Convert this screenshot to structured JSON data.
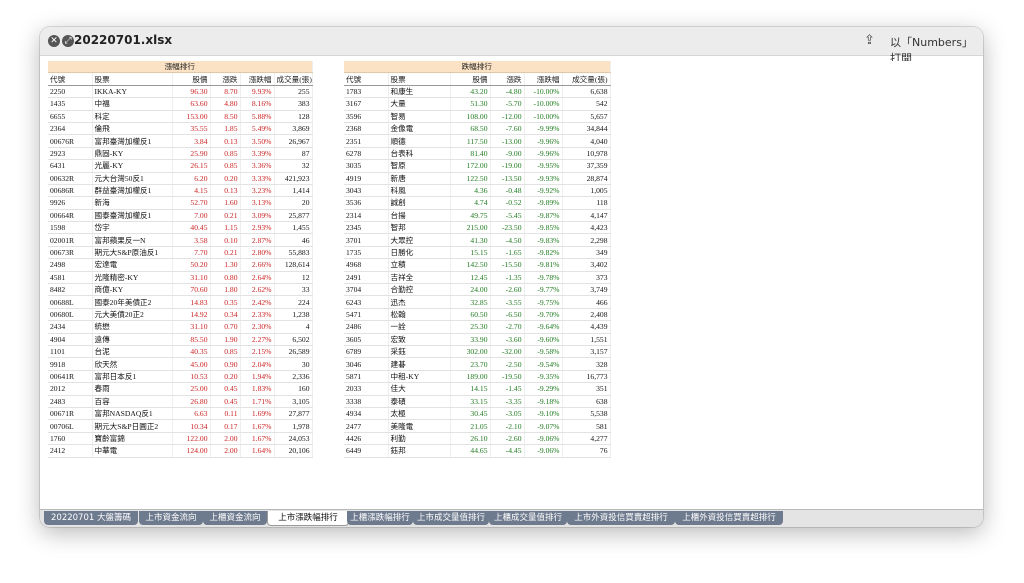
{
  "window": {
    "title": "20220701.xlsx",
    "open_with": "以「Numbers」打開"
  },
  "gainers": {
    "title": "漲幅排行",
    "columns": [
      "代號",
      "股票",
      "股價",
      "漲跌",
      "漲跌幅",
      "成交量(張)"
    ],
    "rows": [
      [
        "2250",
        "IKKA-KY",
        "96.30",
        "8.70",
        "9.93%",
        "255"
      ],
      [
        "1435",
        "中福",
        "63.60",
        "4.80",
        "8.16%",
        "383"
      ],
      [
        "6655",
        "科定",
        "153.00",
        "8.50",
        "5.88%",
        "128"
      ],
      [
        "2364",
        "倫飛",
        "35.55",
        "1.85",
        "5.49%",
        "3,869"
      ],
      [
        "00676R",
        "富邦臺灣加權反1",
        "3.84",
        "0.13",
        "3.50%",
        "26,967"
      ],
      [
        "2923",
        "鼎固-KY",
        "25.90",
        "0.85",
        "3.39%",
        "87"
      ],
      [
        "6431",
        "光麗-KY",
        "26.15",
        "0.85",
        "3.36%",
        "32"
      ],
      [
        "00632R",
        "元大台灣50反1",
        "6.20",
        "0.20",
        "3.33%",
        "421,923"
      ],
      [
        "00686R",
        "群益臺灣加權反1",
        "4.15",
        "0.13",
        "3.23%",
        "1,414"
      ],
      [
        "9926",
        "新海",
        "52.70",
        "1.60",
        "3.13%",
        "20"
      ],
      [
        "00664R",
        "國泰臺灣加權反1",
        "7.00",
        "0.21",
        "3.09%",
        "25,877"
      ],
      [
        "1598",
        "岱宇",
        "40.45",
        "1.15",
        "2.93%",
        "1,455"
      ],
      [
        "02001R",
        "富邦蘋果反一N",
        "3.58",
        "0.10",
        "2.87%",
        "46"
      ],
      [
        "00673R",
        "期元大S&P原油反1",
        "7.70",
        "0.21",
        "2.80%",
        "55,883"
      ],
      [
        "2498",
        "宏達電",
        "50.20",
        "1.30",
        "2.66%",
        "128,614"
      ],
      [
        "4581",
        "光隆精密-KY",
        "31.10",
        "0.80",
        "2.64%",
        "12"
      ],
      [
        "8482",
        "商億-KY",
        "70.60",
        "1.80",
        "2.62%",
        "33"
      ],
      [
        "00688L",
        "國泰20年美債正2",
        "14.83",
        "0.35",
        "2.42%",
        "224"
      ],
      [
        "00680L",
        "元大美債20正2",
        "14.92",
        "0.34",
        "2.33%",
        "1,238"
      ],
      [
        "2434",
        "統懋",
        "31.10",
        "0.70",
        "2.30%",
        "4"
      ],
      [
        "4904",
        "遠傳",
        "85.50",
        "1.90",
        "2.27%",
        "6,502"
      ],
      [
        "1101",
        "台泥",
        "40.35",
        "0.85",
        "2.15%",
        "26,589"
      ],
      [
        "9918",
        "欣天然",
        "45.00",
        "0.90",
        "2.04%",
        "30"
      ],
      [
        "00641R",
        "富邦日本反1",
        "10.53",
        "0.20",
        "1.94%",
        "2,336"
      ],
      [
        "2012",
        "春雨",
        "25.00",
        "0.45",
        "1.83%",
        "160"
      ],
      [
        "2483",
        "百容",
        "26.80",
        "0.45",
        "1.71%",
        "3,105"
      ],
      [
        "00671R",
        "富邦NASDAQ反1",
        "6.63",
        "0.11",
        "1.69%",
        "27,877"
      ],
      [
        "00706L",
        "期元大S&P日圓正2",
        "10.34",
        "0.17",
        "1.67%",
        "1,978"
      ],
      [
        "1760",
        "寶齡富錦",
        "122.00",
        "2.00",
        "1.67%",
        "24,053"
      ],
      [
        "2412",
        "中華電",
        "124.00",
        "2.00",
        "1.64%",
        "20,106"
      ]
    ]
  },
  "losers": {
    "title": "跌幅排行",
    "columns": [
      "代號",
      "股票",
      "股價",
      "漲跌",
      "漲跌幅",
      "成交量(張)"
    ],
    "rows": [
      [
        "1783",
        "和康生",
        "43.20",
        "-4.80",
        "-10.00%",
        "6,638"
      ],
      [
        "3167",
        "大量",
        "51.30",
        "-5.70",
        "-10.00%",
        "542"
      ],
      [
        "3596",
        "智易",
        "108.00",
        "-12.00",
        "-10.00%",
        "5,657"
      ],
      [
        "2368",
        "金像電",
        "68.50",
        "-7.60",
        "-9.99%",
        "34,844"
      ],
      [
        "2351",
        "順德",
        "117.50",
        "-13.00",
        "-9.96%",
        "4,040"
      ],
      [
        "6278",
        "台表科",
        "81.40",
        "-9.00",
        "-9.96%",
        "10,978"
      ],
      [
        "3035",
        "智原",
        "172.00",
        "-19.00",
        "-9.95%",
        "37,359"
      ],
      [
        "4919",
        "新唐",
        "122.50",
        "-13.50",
        "-9.93%",
        "28,874"
      ],
      [
        "3043",
        "科風",
        "4.36",
        "-0.48",
        "-9.92%",
        "1,005"
      ],
      [
        "3536",
        "誠創",
        "4.74",
        "-0.52",
        "-9.89%",
        "118"
      ],
      [
        "2314",
        "台揚",
        "49.75",
        "-5.45",
        "-9.87%",
        "4,147"
      ],
      [
        "2345",
        "智邦",
        "215.00",
        "-23.50",
        "-9.85%",
        "4,423"
      ],
      [
        "3701",
        "大眾控",
        "41.30",
        "-4.50",
        "-9.83%",
        "2,298"
      ],
      [
        "1735",
        "日勝化",
        "15.15",
        "-1.65",
        "-9.82%",
        "349"
      ],
      [
        "4968",
        "立積",
        "142.50",
        "-15.50",
        "-9.81%",
        "3,402"
      ],
      [
        "2491",
        "吉祥全",
        "12.45",
        "-1.35",
        "-9.78%",
        "373"
      ],
      [
        "3704",
        "合勤控",
        "24.00",
        "-2.60",
        "-9.77%",
        "3,749"
      ],
      [
        "6243",
        "迅杰",
        "32.85",
        "-3.55",
        "-9.75%",
        "466"
      ],
      [
        "5471",
        "松翰",
        "60.50",
        "-6.50",
        "-9.70%",
        "2,408"
      ],
      [
        "2486",
        "一詮",
        "25.30",
        "-2.70",
        "-9.64%",
        "4,439"
      ],
      [
        "3605",
        "宏致",
        "33.90",
        "-3.60",
        "-9.60%",
        "1,551"
      ],
      [
        "6789",
        "采鈺",
        "302.00",
        "-32.00",
        "-9.58%",
        "3,157"
      ],
      [
        "3046",
        "建碁",
        "23.70",
        "-2.50",
        "-9.54%",
        "328"
      ],
      [
        "5871",
        "中租-KY",
        "189.00",
        "-19.50",
        "-9.35%",
        "16,773"
      ],
      [
        "2033",
        "佳大",
        "14.15",
        "-1.45",
        "-9.29%",
        "351"
      ],
      [
        "3338",
        "泰碩",
        "33.15",
        "-3.35",
        "-9.18%",
        "638"
      ],
      [
        "4934",
        "太極",
        "30.45",
        "-3.05",
        "-9.10%",
        "5,538"
      ],
      [
        "2477",
        "美隆電",
        "21.05",
        "-2.10",
        "-9.07%",
        "581"
      ],
      [
        "4426",
        "利勤",
        "26.10",
        "-2.60",
        "-9.06%",
        "4,277"
      ],
      [
        "6449",
        "鈺邦",
        "44.65",
        "-4.45",
        "-9.06%",
        "76"
      ]
    ]
  },
  "tabs": [
    {
      "label": "20220701 大盤籌碼",
      "active": false
    },
    {
      "label": "上市資金流向",
      "active": false
    },
    {
      "label": "上櫃資金流向",
      "active": false
    },
    {
      "label": "上市漲跌幅排行",
      "active": true
    },
    {
      "label": "上櫃漲跌幅排行",
      "active": false
    },
    {
      "label": "上市成交量值排行",
      "active": false
    },
    {
      "label": "上櫃成交量值排行",
      "active": false
    },
    {
      "label": "上市外資投信買賣超排行",
      "active": false
    },
    {
      "label": "上櫃外資投信買賣超排行",
      "active": false
    }
  ],
  "icons": {
    "close": "close-icon",
    "fullscreen": "fullscreen-icon",
    "share": "share-icon"
  },
  "colors": {
    "gain": "#cc1e1e",
    "loss": "#1d7a1d",
    "header_fill": "#fbe2c4"
  }
}
